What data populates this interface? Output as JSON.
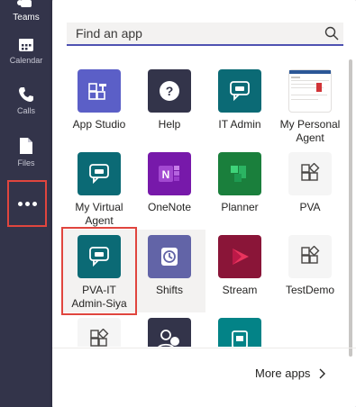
{
  "rail": {
    "teams_label": "Teams",
    "calendar_label": "Calendar",
    "calls_label": "Calls",
    "files_label": "Files"
  },
  "search": {
    "placeholder": "Find an app"
  },
  "apps": [
    {
      "label": "App Studio",
      "icon": "app-studio-icon",
      "color": "#5b5fc7"
    },
    {
      "label": "Help",
      "icon": "help-icon",
      "color": "#33344a"
    },
    {
      "label": "IT Admin",
      "icon": "chat-bot-icon",
      "color": "#0b6a75"
    },
    {
      "label": "My Personal Agent",
      "icon": "personal-agent-thumbnail",
      "color": "#ffffff"
    },
    {
      "label": "My Virtual Agent",
      "icon": "chat-bot-icon",
      "color": "#0b6a75"
    },
    {
      "label": "OneNote",
      "icon": "onenote-icon",
      "color": "#7719aa"
    },
    {
      "label": "Planner",
      "icon": "planner-icon",
      "color": "#1a7f3c"
    },
    {
      "label": "PVA",
      "icon": "app-placeholder-icon",
      "color": "#f5f5f5"
    },
    {
      "label": "PVA-IT Admin-Siya",
      "icon": "chat-bot-icon",
      "color": "#0b6a75"
    },
    {
      "label": "Shifts",
      "icon": "shifts-icon",
      "color": "#6264a7"
    },
    {
      "label": "Stream",
      "icon": "stream-icon",
      "color": "#8a1538"
    },
    {
      "label": "TestDemo",
      "icon": "app-placeholder-icon",
      "color": "#f5f5f5"
    },
    {
      "label": "",
      "icon": "app-placeholder-icon",
      "color": "#f5f5f5"
    },
    {
      "label": "",
      "icon": "people-icon",
      "color": "#33344a"
    },
    {
      "label": "",
      "icon": "forms-icon",
      "color": "#038387"
    }
  ],
  "more_apps_label": "More apps",
  "colors": {
    "rail_bg": "#33344a",
    "highlight": "#e0453e",
    "accent": "#4f52b2"
  }
}
